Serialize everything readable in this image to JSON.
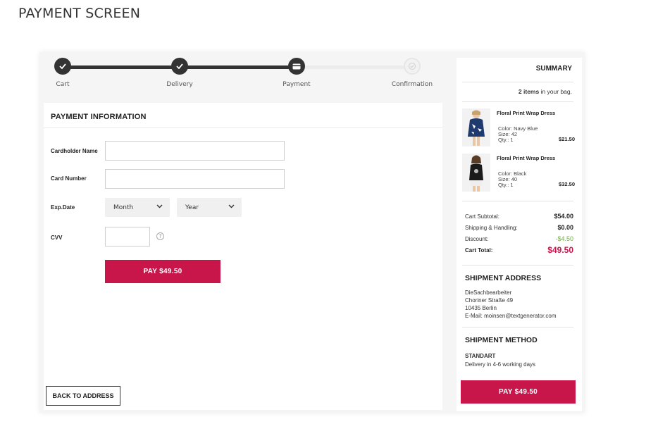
{
  "page_title": "PAYMENT SCREEN",
  "steps": [
    {
      "label": "Cart",
      "state": "done"
    },
    {
      "label": "Delivery",
      "state": "done"
    },
    {
      "label": "Payment",
      "state": "active"
    },
    {
      "label": "Confirmation",
      "state": "todo"
    }
  ],
  "payment": {
    "title": "PAYMENT INFORMATION",
    "cardholder_label": "Cardholder Name",
    "cardholder_value": "",
    "card_number_label": "Card Number",
    "card_number_value": "",
    "exp_label": "Exp.Date",
    "month_selected": "Month",
    "year_selected": "Year",
    "cvv_label": "CVV",
    "cvv_value": "",
    "help_glyph": "?",
    "pay_button": "PAY $49.50",
    "back_button": "BACK TO ADDRESS"
  },
  "summary": {
    "title": "SUMMARY",
    "items_count": "2 items",
    "items_suffix": " in your bag.",
    "products": [
      {
        "name": "Floral Print Wrap Dress",
        "color": "Color: Navy Blue",
        "size": "Size:  42",
        "qty": "Qty.:  1",
        "price": "$21.50"
      },
      {
        "name": "Floral Print Wrap Dress",
        "color": "Color: Black",
        "size": "Size:  40",
        "qty": "Qty.:  1",
        "price": "$32.50"
      }
    ],
    "subtotal_label": "Cart Subtotal:",
    "subtotal": "$54.00",
    "shipping_label": "Shipping & Handling:",
    "shipping": "$0.00",
    "discount_label": "Discount:",
    "discount": "-$4.50",
    "total_label": "Cart Total:",
    "total": "$49.50",
    "address_title": "SHIPMENT ADDRESS",
    "address_lines": [
      "DieSachbearbeiter",
      "Choriner Straße 49",
      "10435 Berlin",
      "E-Mail: moinsen@textgenerator.com"
    ],
    "method_title": "SHIPMENT METHOD",
    "method_name": "STANDART",
    "method_detail": "Delivery in 4-6 working days",
    "pay_button": "PAY $49.50"
  },
  "colors": {
    "accent": "#c8164a",
    "discount": "#6fae3f",
    "dark": "#333333"
  },
  "icons": [
    "check-icon",
    "card-icon",
    "pending-check-icon",
    "chevron-down-icon",
    "help-icon"
  ]
}
